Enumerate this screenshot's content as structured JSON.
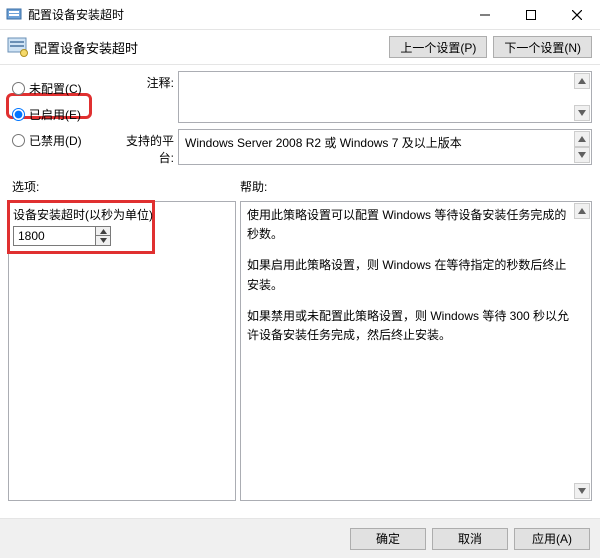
{
  "titlebar": {
    "title": "配置设备安装超时"
  },
  "header": {
    "heading": "配置设备安装超时",
    "prev_btn": "上一个设置(P)",
    "next_btn": "下一个设置(N)"
  },
  "radios": {
    "not_configured": "未配置(C)",
    "enabled": "已启用(E)",
    "disabled": "已禁用(D)",
    "selected": "enabled"
  },
  "comment": {
    "label": "注释:"
  },
  "platform": {
    "label": "支持的平台:",
    "value": "Windows Server 2008 R2 或 Windows 7 及以上版本"
  },
  "options": {
    "label": "选项:"
  },
  "help": {
    "label": "帮助:"
  },
  "option_panel": {
    "field_label": "设备安装超时(以秒为单位)",
    "field_value": "1800"
  },
  "help_text": {
    "p1": "使用此策略设置可以配置 Windows 等待设备安装任务完成的秒数。",
    "p2": "如果启用此策略设置，则 Windows 在等待指定的秒数后终止安装。",
    "p3": "如果禁用或未配置此策略设置，则 Windows 等待 300 秒以允许设备安装任务完成，然后终止安装。"
  },
  "footer": {
    "ok": "确定",
    "cancel": "取消",
    "apply": "应用(A)"
  }
}
